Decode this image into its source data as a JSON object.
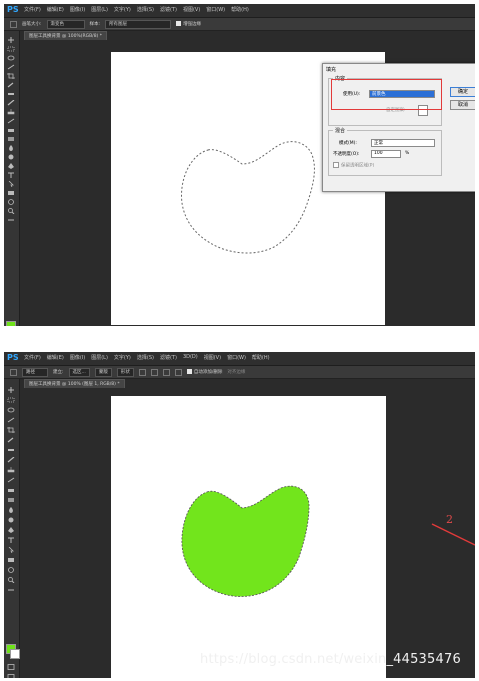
{
  "app": {
    "logo": "PS"
  },
  "colors": {
    "foreground": "#6fe21a",
    "selection_fill": "#72e51c",
    "annotation": "#e23a3a"
  },
  "panel1": {
    "menu": [
      "文件(F)",
      "编辑(E)",
      "图像(I)",
      "图层(L)",
      "文字(Y)",
      "选择(S)",
      "滤镜(T)",
      "视图(V)",
      "窗口(W)",
      "帮助(H)"
    ],
    "options": {
      "brush_size_label": "画笔大小:",
      "brush_value": "渐变色",
      "sample_label": "样本:",
      "sample_value": "所有图层",
      "enhance_edge": "增强边缘"
    },
    "doc_tab": "图层工具换背景 @ 100%(RGB/8) *",
    "dialog": {
      "title": "填充",
      "content_group": "内容",
      "use_label": "使用(U):",
      "use_value": "前景色",
      "custom_pattern": "自定图案:",
      "blend_group": "混合",
      "mode_label": "模式(M):",
      "mode_value": "正常",
      "opacity_label": "不透明度(O):",
      "opacity_value": "100",
      "opacity_unit": "%",
      "preserve_transparency": "保留透明区域(P)",
      "ok": "确定",
      "cancel": "取消"
    }
  },
  "panel2": {
    "menu": [
      "文件(F)",
      "编辑(E)",
      "图像(I)",
      "图层(L)",
      "文字(Y)",
      "选择(S)",
      "滤镜(T)",
      "3D(D)",
      "视图(V)",
      "窗口(W)",
      "帮助(H)"
    ],
    "options": {
      "mode_value": "路径",
      "build_label": "建立:",
      "selection_btn": "选区...",
      "mask_btn": "蒙版",
      "shape_btn": "形状",
      "auto_add": "自动添加/删除",
      "align_edges": "对齐边缘"
    },
    "doc_tab": "图层工具换背景 @ 100% (图层 1, RGB/8) *"
  },
  "annotation_number": "2",
  "watermark": "https://blog.csdn.net/weixin_44535476"
}
